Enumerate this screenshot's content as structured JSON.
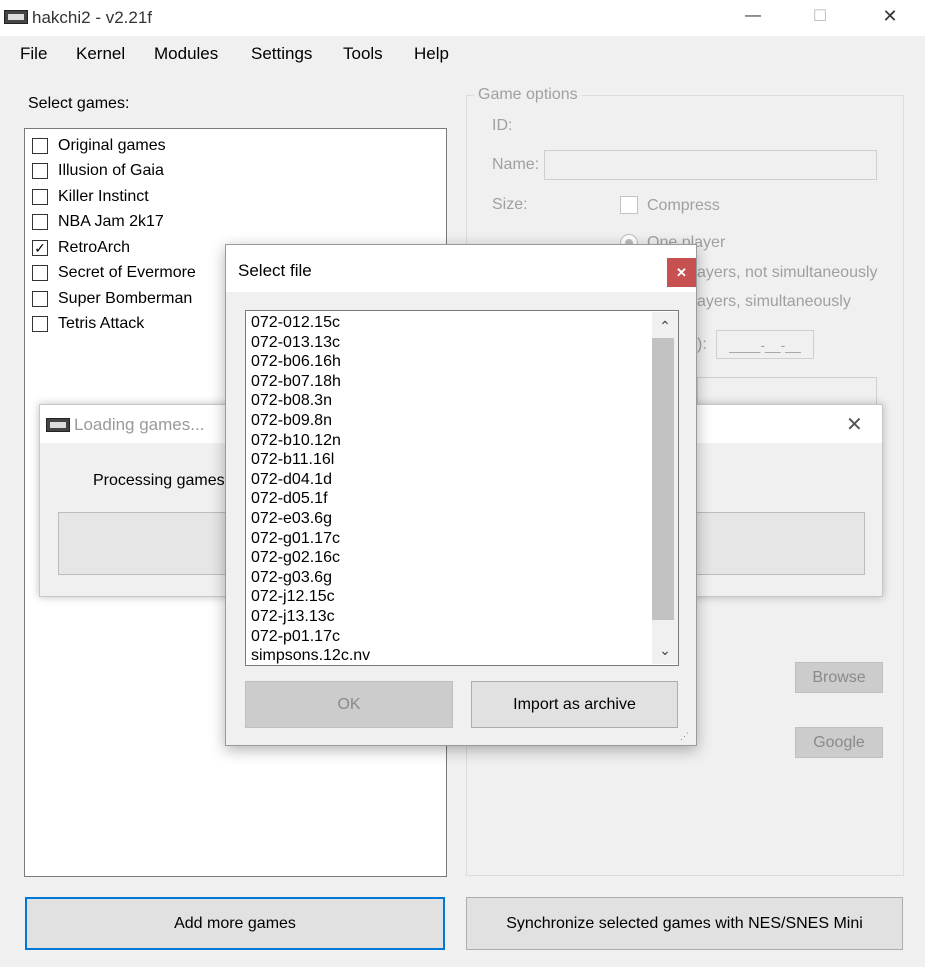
{
  "window": {
    "title": "hakchi2 - v2.21f",
    "minimize": "—",
    "maximize": "☐",
    "close": "✕"
  },
  "menu": [
    "File",
    "Kernel",
    "Modules",
    "Settings",
    "Tools",
    "Help"
  ],
  "left": {
    "select_label": "Select games:",
    "games": [
      {
        "name": "Original games",
        "checked": false
      },
      {
        "name": "Illusion of Gaia",
        "checked": false
      },
      {
        "name": "Killer Instinct",
        "checked": false
      },
      {
        "name": "NBA Jam 2k17",
        "checked": false
      },
      {
        "name": "RetroArch",
        "checked": true
      },
      {
        "name": "Secret of Evermore",
        "checked": false
      },
      {
        "name": "Super Bomberman",
        "checked": false
      },
      {
        "name": "Tetris Attack",
        "checked": false
      }
    ],
    "add_button": "Add more games"
  },
  "game_options": {
    "title": "Game options",
    "id_label": "ID:",
    "name_label": "Name:",
    "size_label": "Size:",
    "compress_label": "Compress",
    "one_player": "One player",
    "not_simul": "ayers, not simultaneously",
    "simul": "ayers, simultaneously",
    "date_label_fragment": "):",
    "date_value": "____-__-__",
    "browse_button": "Browse",
    "google_button": "Google"
  },
  "sync_button": "Synchronize selected games with NES/SNES Mini",
  "loading": {
    "title": "Loading games...",
    "close": "✕",
    "message": "Processing games,"
  },
  "dialog": {
    "title": "Select file",
    "close": "✕",
    "files": [
      "072-012.15c",
      "072-013.13c",
      "072-b06.16h",
      "072-b07.18h",
      "072-b08.3n",
      "072-b09.8n",
      "072-b10.12n",
      "072-b11.16l",
      "072-d04.1d",
      "072-d05.1f",
      "072-e03.6g",
      "072-g01.17c",
      "072-g02.16c",
      "072-g03.6g",
      "072-j12.15c",
      "072-j13.13c",
      "072-p01.17c",
      "simpsons.12c.nv"
    ],
    "scroll_up": "⌃",
    "scroll_down": "⌄",
    "ok_button": "OK",
    "import_button": "Import as archive",
    "grip": "⋰"
  }
}
